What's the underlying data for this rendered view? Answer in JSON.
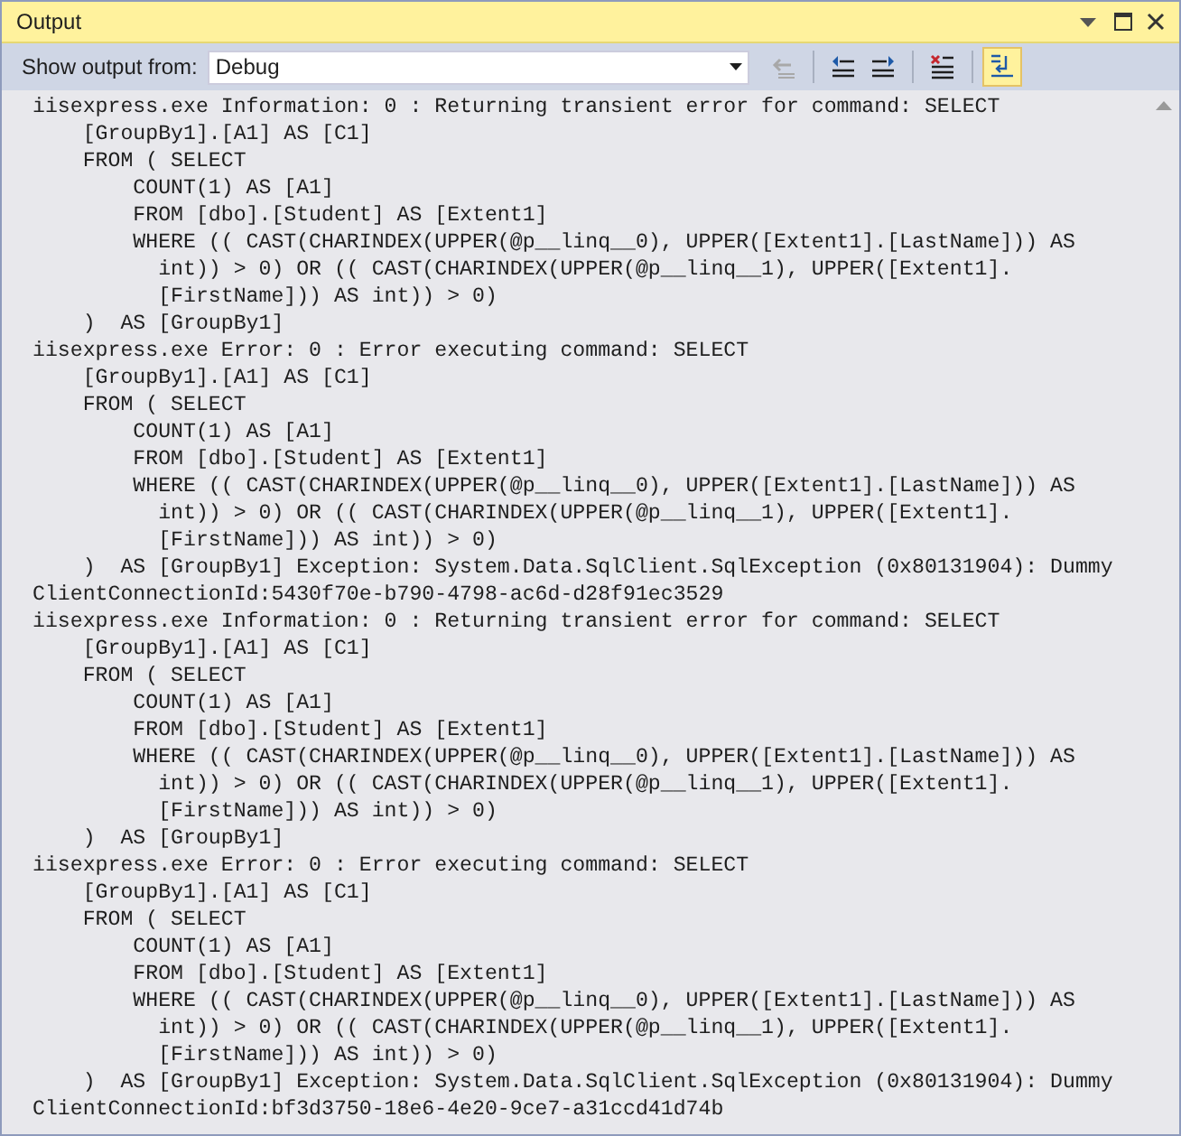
{
  "window": {
    "title": "Output"
  },
  "toolbar": {
    "source_label": "Show output from:",
    "source_value": "Debug",
    "buttons": [
      {
        "kind": "goto",
        "disabled": true,
        "selected": false
      },
      {
        "kind": "prev",
        "disabled": false,
        "selected": false
      },
      {
        "kind": "next",
        "disabled": false,
        "selected": false
      },
      {
        "kind": "clear",
        "disabled": false,
        "selected": false
      },
      {
        "kind": "wrap",
        "disabled": false,
        "selected": true
      }
    ]
  },
  "output_lines": [
    "iisexpress.exe Information: 0 : Returning transient error for command: SELECT",
    "    [GroupBy1].[A1] AS [C1]",
    "    FROM ( SELECT",
    "        COUNT(1) AS [A1]",
    "        FROM [dbo].[Student] AS [Extent1]",
    "        WHERE (( CAST(CHARINDEX(UPPER(@p__linq__0), UPPER([Extent1].[LastName])) AS",
    "          int)) > 0) OR (( CAST(CHARINDEX(UPPER(@p__linq__1), UPPER([Extent1].",
    "          [FirstName])) AS int)) > 0)",
    "    )  AS [GroupBy1]",
    "iisexpress.exe Error: 0 : Error executing command: SELECT",
    "    [GroupBy1].[A1] AS [C1]",
    "    FROM ( SELECT",
    "        COUNT(1) AS [A1]",
    "        FROM [dbo].[Student] AS [Extent1]",
    "        WHERE (( CAST(CHARINDEX(UPPER(@p__linq__0), UPPER([Extent1].[LastName])) AS",
    "          int)) > 0) OR (( CAST(CHARINDEX(UPPER(@p__linq__1), UPPER([Extent1].",
    "          [FirstName])) AS int)) > 0)",
    "    )  AS [GroupBy1] Exception: System.Data.SqlClient.SqlException (0x80131904): Dummy",
    "ClientConnectionId:5430f70e-b790-4798-ac6d-d28f91ec3529",
    "iisexpress.exe Information: 0 : Returning transient error for command: SELECT",
    "    [GroupBy1].[A1] AS [C1]",
    "    FROM ( SELECT",
    "        COUNT(1) AS [A1]",
    "        FROM [dbo].[Student] AS [Extent1]",
    "        WHERE (( CAST(CHARINDEX(UPPER(@p__linq__0), UPPER([Extent1].[LastName])) AS",
    "          int)) > 0) OR (( CAST(CHARINDEX(UPPER(@p__linq__1), UPPER([Extent1].",
    "          [FirstName])) AS int)) > 0)",
    "    )  AS [GroupBy1]",
    "iisexpress.exe Error: 0 : Error executing command: SELECT",
    "    [GroupBy1].[A1] AS [C1]",
    "    FROM ( SELECT",
    "        COUNT(1) AS [A1]",
    "        FROM [dbo].[Student] AS [Extent1]",
    "        WHERE (( CAST(CHARINDEX(UPPER(@p__linq__0), UPPER([Extent1].[LastName])) AS",
    "          int)) > 0) OR (( CAST(CHARINDEX(UPPER(@p__linq__1), UPPER([Extent1].",
    "          [FirstName])) AS int)) > 0)",
    "    )  AS [GroupBy1] Exception: System.Data.SqlClient.SqlException (0x80131904): Dummy",
    "ClientConnectionId:bf3d3750-18e6-4e20-9ce7-a31ccd41d74b"
  ]
}
